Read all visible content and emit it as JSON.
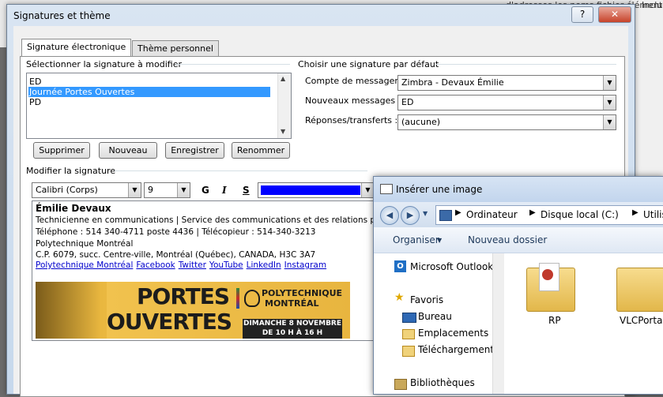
{
  "background": {
    "items": [
      "d'adresses les noms",
      "fichier élément",
      "Inclu"
    ]
  },
  "sig_dialog": {
    "title": "Signatures et thème",
    "help_btn": "?",
    "close_btn": "✕",
    "tabs": [
      "Signature électronique",
      "Thème personnel"
    ],
    "select_label": "Sélectionner la signature à modifier",
    "signatures": [
      "ED",
      "Journée Portes Ouvertes",
      "PD"
    ],
    "buttons": {
      "delete": "Supprimer",
      "new": "Nouveau",
      "save": "Enregistrer",
      "rename": "Renommer"
    },
    "default_group": "Choisir une signature par défaut",
    "account_label": "Compte de messagerie :",
    "account_value": "Zimbra - Devaux Émilie",
    "new_msg_label": "Nouveaux messages :",
    "new_msg_value": "ED",
    "reply_label": "Réponses/transferts :",
    "reply_value": "(aucune)",
    "edit_label": "Modifier la signature",
    "font_value": "Calibri (Corps)",
    "size_value": "9",
    "bold": "G",
    "italic": "I",
    "underline": "S",
    "font_color": "#0000ff",
    "signature": {
      "name": "Émilie Devaux",
      "line1": "Technicienne en communications  |  Service des communications et des relations publi",
      "line2": "Téléphone : 514 340-4711 poste 4436  | Télécopieur : 514-340-3213",
      "line3": "Polytechnique Montréal",
      "line4": "C.P. 6079, succ. Centre-ville, Montréal (Québec), CANADA, H3C 3A7",
      "links": [
        "Polytechnique Montréal",
        "Facebook",
        "Twitter",
        "YouTube",
        "LinkedIn",
        "Instagram"
      ]
    },
    "banner": {
      "big1": "PORTES",
      "big2": "OUVERTES",
      "poly1": "POLYTECHNIQUE",
      "poly2": "MONTRÉAL",
      "date1": "DIMANCHE 8 NOVEMBRE",
      "date2": "DE 10 H À 16 H"
    }
  },
  "img_dialog": {
    "title": "Insérer une image",
    "path": [
      "Ordinateur",
      "Disque local (C:)",
      "Utilisateurs"
    ],
    "toolbar_organize": "Organiser",
    "toolbar_newfolder": "Nouveau dossier",
    "nav": {
      "outlook": "Microsoft Outlook",
      "favorites": "Favoris",
      "desktop": "Bureau",
      "recent": "Emplacements ré",
      "downloads": "Téléchargements",
      "libraries": "Bibliothèques"
    },
    "folders": [
      "RP",
      "VLCPortab"
    ]
  }
}
